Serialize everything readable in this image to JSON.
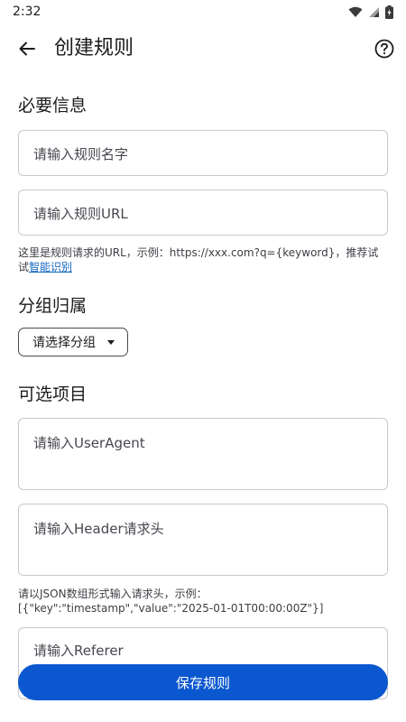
{
  "status_bar": {
    "time": "2:32"
  },
  "app_bar": {
    "title": "创建规则"
  },
  "sections": {
    "required": "必要信息",
    "group": "分组归属",
    "optional": "可选项目"
  },
  "fields": {
    "rule_name_placeholder": "请输入规则名字",
    "rule_url_placeholder": "请输入规则URL",
    "user_agent_placeholder": "请输入UserAgent",
    "header_placeholder": "请输入Header请求头",
    "referer_placeholder": "请输入Referer"
  },
  "helpers": {
    "url_hint": "这里是规则请求的URL，示例：https://xxx.com?q={keyword}，推荐试试",
    "url_hint_link": "智能识别",
    "header_hint_line1": "请以JSON数组形式输入请求头，示例：",
    "header_hint_line2": "[{\"key\":\"timestamp\",\"value\":\"2025-01-01T00:00:00Z\"}]"
  },
  "group_select": {
    "label": "请选择分组"
  },
  "actions": {
    "save_label": "保存规则"
  },
  "colors": {
    "primary": "#0b57cf",
    "link": "#1565c0",
    "outline": "#c9c7cc"
  }
}
